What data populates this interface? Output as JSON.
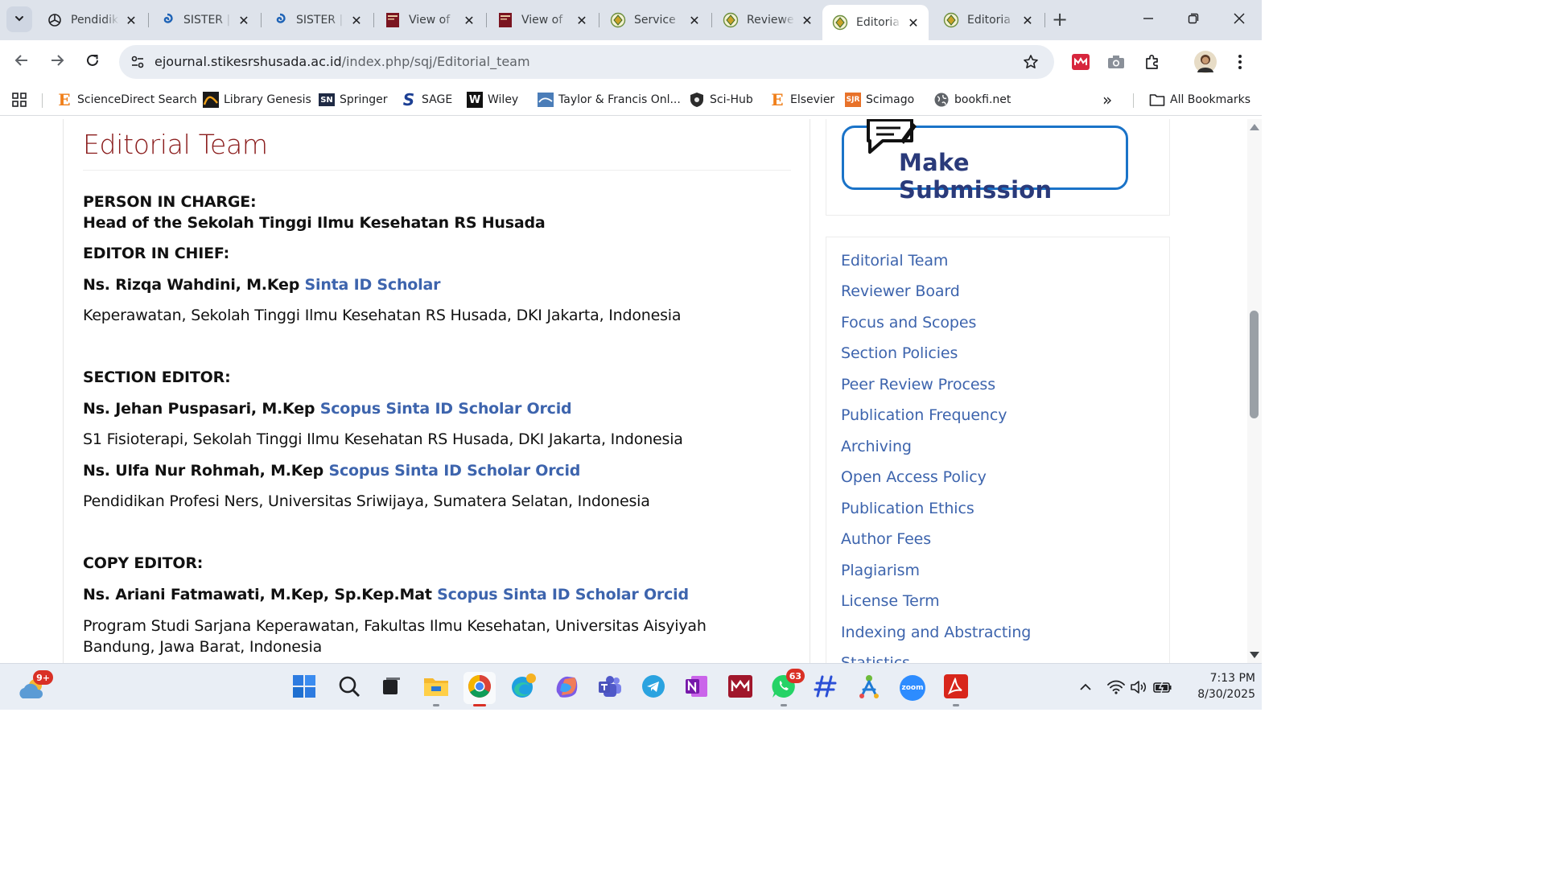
{
  "browser": {
    "tabs": [
      {
        "label": "Pendidik",
        "icon": "openai-icon"
      },
      {
        "label": "SISTER |",
        "icon": "sister-icon"
      },
      {
        "label": "SISTER |",
        "icon": "sister-icon"
      },
      {
        "label": "View of",
        "icon": "journal-cover-icon"
      },
      {
        "label": "View of",
        "icon": "journal-cover-icon"
      },
      {
        "label": "Service",
        "icon": "stikes-logo-icon"
      },
      {
        "label": "Reviewe",
        "icon": "stikes-logo-icon"
      },
      {
        "label": "Editoria",
        "icon": "stikes-logo-icon",
        "active": true
      },
      {
        "label": "Editoria",
        "icon": "stikes-logo-icon"
      }
    ],
    "tab_close_glyph": "✕",
    "new_tab_glyph": "+",
    "url_host": "ejournal.stikesrshusada.ac.id",
    "url_path": "/index.php/sqj/Editorial_team",
    "bookmarks": [
      {
        "label": "ScienceDirect Search",
        "icon": "E"
      },
      {
        "label": "Library Genesis",
        "icon": "libgen-icon"
      },
      {
        "label": "Springer",
        "icon": "SN"
      },
      {
        "label": "SAGE",
        "icon": "S"
      },
      {
        "label": "Wiley",
        "icon": "W"
      },
      {
        "label": "Taylor & Francis Onl...",
        "icon": "tandf-icon"
      },
      {
        "label": "Sci-Hub",
        "icon": "scihub-icon"
      },
      {
        "label": "Elsevier",
        "icon": "E"
      },
      {
        "label": "Scimago",
        "icon": "SJR"
      },
      {
        "label": "bookfi.net",
        "icon": "globe-icon"
      }
    ],
    "bookmarks_more_glyph": "»",
    "all_bookmarks_label": "All Bookmarks"
  },
  "page": {
    "title": "Editorial Team",
    "lines": [
      {
        "text": "PERSON IN CHARGE:",
        "style": "b"
      },
      {
        "text": "Head of the Sekolah Tinggi Ilmu Kesehatan RS Husada",
        "style": "b"
      },
      {
        "text": "EDITOR IN CHIEF:",
        "style": "b"
      },
      {
        "name": "Ns. Rizqa Wahdini, M.Kep",
        "links": "Sinta ID Scholar"
      },
      {
        "text": "Keperawatan, Sekolah Tinggi Ilmu Kesehatan RS Husada, DKI Jakarta, Indonesia",
        "style": "n"
      },
      {
        "text": "SECTION EDITOR:",
        "style": "b"
      },
      {
        "name": "Ns. Jehan Puspasari, M.Kep",
        "links": "Scopus Sinta ID Scholar Orcid"
      },
      {
        "text": "S1 Fisioterapi, Sekolah Tinggi Ilmu Kesehatan RS Husada, DKI Jakarta, Indonesia",
        "style": "n"
      },
      {
        "name": "Ns. Ulfa Nur Rohmah, M.Kep",
        "links": "Scopus Sinta ID Scholar Orcid"
      },
      {
        "text": "Pendidikan Profesi Ners, Universitas Sriwijaya, Sumatera Selatan, Indonesia",
        "style": "n"
      },
      {
        "text": "COPY EDITOR:",
        "style": "b"
      },
      {
        "name": "Ns. Ariani Fatmawati, M.Kep, Sp.Kep.Mat",
        "links": "Scopus Sinta ID Scholar Orcid"
      },
      {
        "text": "Program Studi Sarjana Keperawatan, Fakultas Ilmu Kesehatan, Universitas Aisyiyah Bandung, Jawa Barat, Indonesia",
        "style": "n"
      }
    ]
  },
  "sidebar": {
    "submission_label": "Make Submission",
    "nav": [
      "Editorial Team",
      "Reviewer Board",
      "Focus and Scopes",
      "Section Policies",
      "Peer Review Process",
      "Publication Frequency",
      "Archiving",
      "Open Access Policy",
      "Publication Ethics",
      "Author Fees",
      "Plagiarism",
      "License Term",
      "Indexing and Abstracting",
      "Statistics"
    ]
  },
  "taskbar": {
    "weather_badge": "9+",
    "whatsapp_badge": "63",
    "zoom_label": "zoom",
    "time": "7:13 PM",
    "date": "8/30/2025"
  },
  "colors": {
    "title": "#8b1d1d",
    "link": "#3d64ad",
    "tabstrip": "#dee3eb",
    "submit_border": "#1a73c8"
  }
}
